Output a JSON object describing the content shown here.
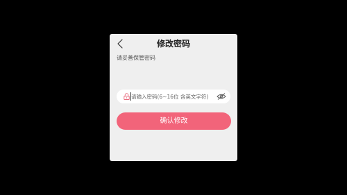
{
  "dialog": {
    "title": "修改密码",
    "subtitle": "请妥善保管密码",
    "back_icon": "chevron-left-icon",
    "password_field": {
      "value": "",
      "placeholder": "请输入密码(6~16位 含英文字符)",
      "lock_icon": "lock-icon",
      "visibility_icon": "eye-hidden-icon"
    },
    "confirm_label": "确认修改"
  },
  "colors": {
    "background": "#000000",
    "dialog_bg": "#efefef",
    "accent": "#f2647a",
    "lock_icon": "#e8677a"
  }
}
